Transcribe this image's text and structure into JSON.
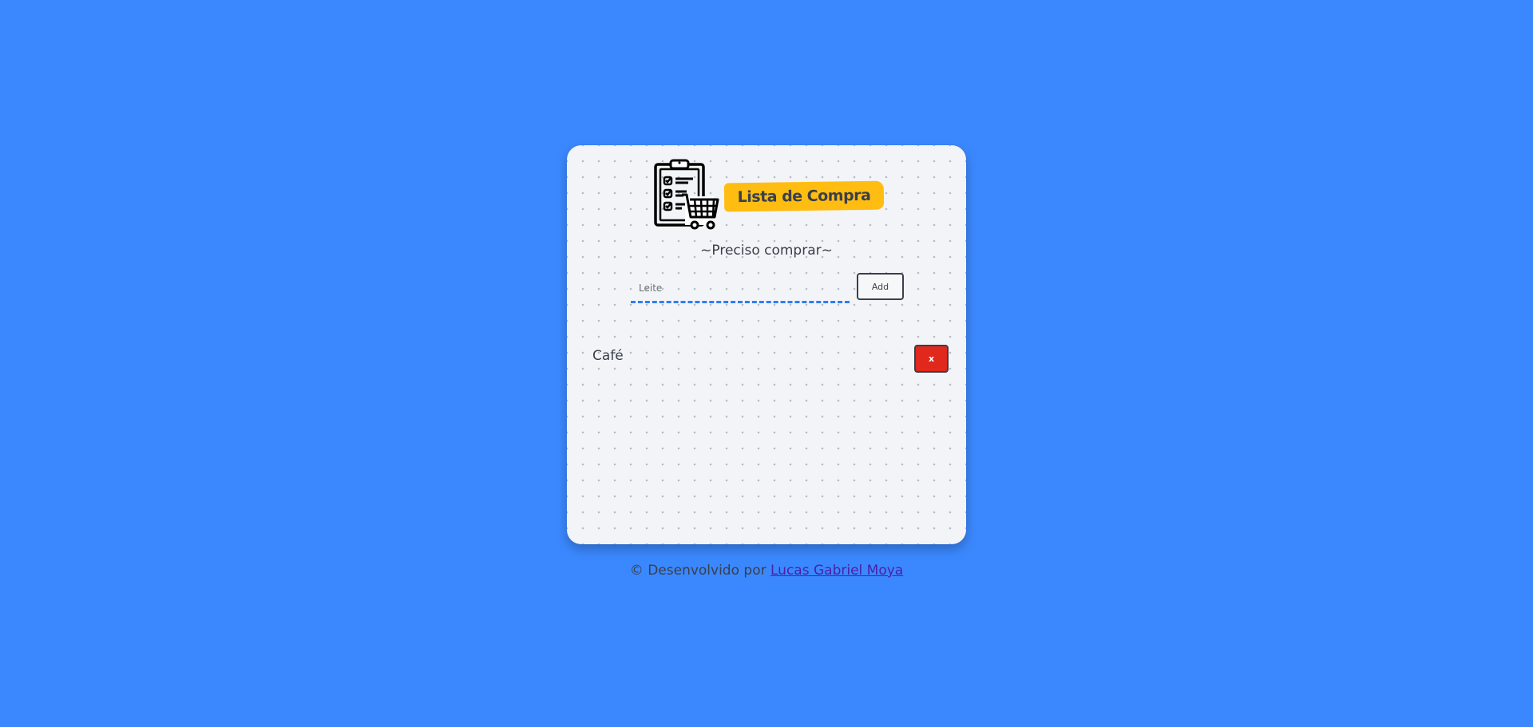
{
  "app": {
    "title": "Lista de Compra",
    "subtitle": "~Preciso comprar~",
    "logo_icon": "clipboard-cart-icon"
  },
  "form": {
    "input_placeholder": "Leite",
    "input_value": "",
    "add_label": "Add"
  },
  "items": [
    {
      "label": "Café",
      "delete_label": "x"
    }
  ],
  "footer": {
    "text": "© Desenvolvido por ",
    "link_text": "Lucas Gabriel Moya"
  },
  "colors": {
    "background": "#3b88fe",
    "card": "#f2f4f7",
    "title_highlight": "#ffbd12",
    "input_underline": "#2f7df6",
    "delete_button": "#e0281c",
    "link": "#4b21a8"
  }
}
